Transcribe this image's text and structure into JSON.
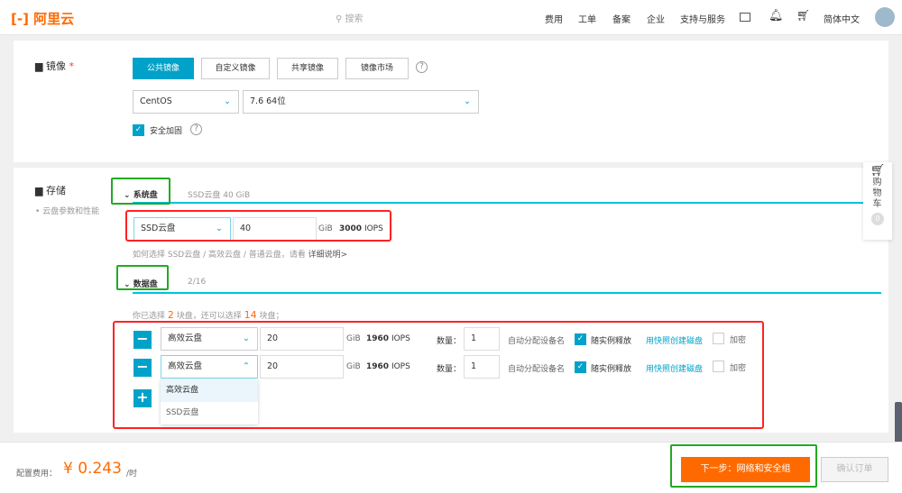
{
  "header": {
    "logo": "[-] 阿里云",
    "search_placeholder": "搜索",
    "nav": [
      "费用",
      "工单",
      "备案",
      "企业",
      "支持与服务"
    ],
    "language": "简体中文"
  },
  "image": {
    "label": "镜像",
    "required": "*",
    "tabs": [
      "公共镜像",
      "自定义镜像",
      "共享镜像",
      "镜像市场"
    ],
    "os": "CentOS",
    "version": "7.6 64位",
    "security": "安全加固"
  },
  "storage": {
    "label": "存储",
    "sub": "云盘参数和性能",
    "system": {
      "title": "系统盘",
      "summary": "SSD云盘   40 GiB",
      "type": "SSD云盘",
      "size": "40",
      "unit": "GiB",
      "iops_value": "3000",
      "iops": "IOPS",
      "hint": "如何选择 SSD云盘 / 高效云盘 / 普通云盘，请看",
      "hint_link": "详细说明>"
    },
    "data": {
      "title": "数据盘",
      "summary": "2/16",
      "selected_pre": "你已选择",
      "selected": "2",
      "selected_mid": "块盘，还可以选择",
      "remaining": "14",
      "selected_post": "块盘；",
      "rows": [
        {
          "type": "高效云盘",
          "size": "20",
          "unit": "GiB",
          "iops_value": "1960",
          "iops": "IOPS",
          "qty_label": "数量：",
          "qty": "1",
          "device": "自动分配设备名",
          "release": "随实例释放",
          "snapshot": "用快照创建磁盘",
          "encrypt": "加密"
        },
        {
          "type": "高效云盘",
          "size": "20",
          "unit": "GiB",
          "iops_value": "1960",
          "iops": "IOPS",
          "qty_label": "数量：",
          "qty": "1",
          "device": "自动分配设备名",
          "release": "随实例释放",
          "snapshot": "用快照创建磁盘",
          "encrypt": "加密"
        }
      ],
      "dropdown": [
        "高效云盘",
        "SSD云盘"
      ]
    }
  },
  "cart": {
    "label": "购物车",
    "count": "0"
  },
  "footer": {
    "cost_label": "配置费用：",
    "currency": "¥",
    "price": "0.243",
    "per": "/时",
    "next": "下一步：网络和安全组",
    "confirm": "确认订单"
  }
}
